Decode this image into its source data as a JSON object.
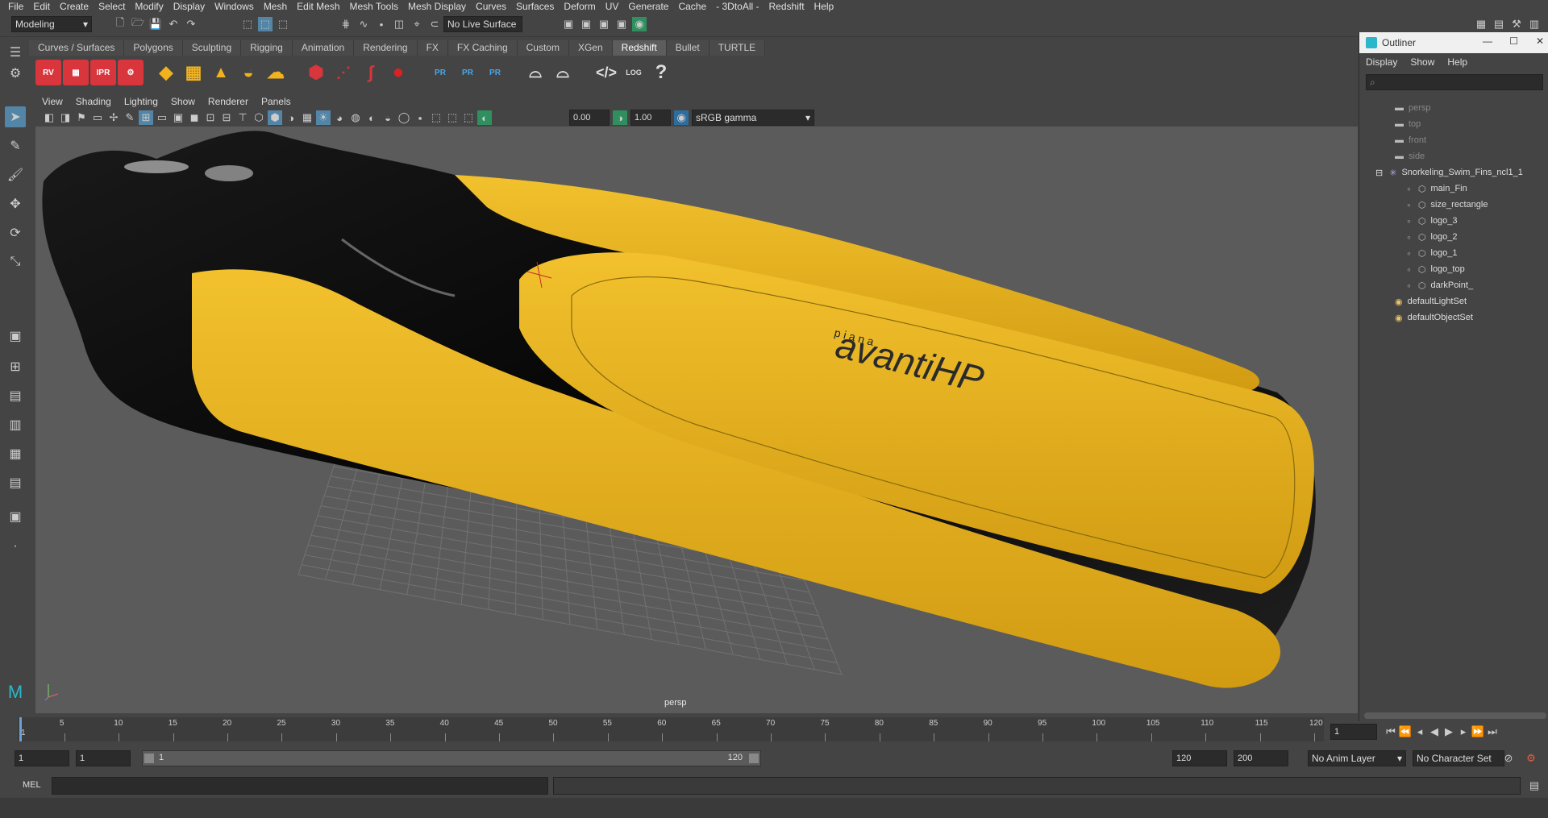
{
  "menubar": [
    "File",
    "Edit",
    "Create",
    "Select",
    "Modify",
    "Display",
    "Windows",
    "Mesh",
    "Edit Mesh",
    "Mesh Tools",
    "Mesh Display",
    "Curves",
    "Surfaces",
    "Deform",
    "UV",
    "Generate",
    "Cache",
    "- 3DtoAll -",
    "Redshift",
    "Help"
  ],
  "statusline": {
    "mode": "Modeling",
    "live_surface": "No Live Surface"
  },
  "shelf_tabs": [
    "Curves / Surfaces",
    "Polygons",
    "Sculpting",
    "Rigging",
    "Animation",
    "Rendering",
    "FX",
    "FX Caching",
    "Custom",
    "XGen",
    "Redshift",
    "Bullet",
    "TURTLE"
  ],
  "active_shelf_tab": "Redshift",
  "shelf_icons": {
    "rv": "RV",
    "ipr": "IPR",
    "pr": "PR",
    "log": "LOG"
  },
  "panel_menu": [
    "View",
    "Shading",
    "Lighting",
    "Show",
    "Renderer",
    "Panels"
  ],
  "panel_tools": {
    "exposure": "0.00",
    "gamma": "1.00",
    "color_space": "sRGB gamma"
  },
  "viewport": {
    "camera_label": "persp",
    "decal_brand": "avantiHP",
    "decal_sub": "p i a n a"
  },
  "outliner": {
    "title": "Outliner",
    "menu": [
      "Display",
      "Show",
      "Help"
    ],
    "items": [
      {
        "label": "persp",
        "type": "camera",
        "indent": 0,
        "dim": true
      },
      {
        "label": "top",
        "type": "camera",
        "indent": 0,
        "dim": true
      },
      {
        "label": "front",
        "type": "camera",
        "indent": 0,
        "dim": true
      },
      {
        "label": "side",
        "type": "camera",
        "indent": 0,
        "dim": true
      },
      {
        "label": "Snorkeling_Swim_Fins_ncl1_1",
        "type": "group",
        "indent": 0,
        "dim": false
      },
      {
        "label": "main_Fin",
        "type": "mesh",
        "indent": 1,
        "dim": false
      },
      {
        "label": "size_rectangle",
        "type": "mesh",
        "indent": 1,
        "dim": false
      },
      {
        "label": "logo_3",
        "type": "mesh",
        "indent": 1,
        "dim": false
      },
      {
        "label": "logo_2",
        "type": "mesh",
        "indent": 1,
        "dim": false
      },
      {
        "label": "logo_1",
        "type": "mesh",
        "indent": 1,
        "dim": false
      },
      {
        "label": "logo_top",
        "type": "mesh",
        "indent": 1,
        "dim": false
      },
      {
        "label": "darkPoint_",
        "type": "mesh",
        "indent": 1,
        "dim": false
      },
      {
        "label": "defaultLightSet",
        "type": "set",
        "indent": 0,
        "dim": false
      },
      {
        "label": "defaultObjectSet",
        "type": "set",
        "indent": 0,
        "dim": false
      }
    ]
  },
  "timeline": {
    "ticks": [
      "5",
      "10",
      "15",
      "20",
      "25",
      "30",
      "35",
      "40",
      "45",
      "50",
      "55",
      "60",
      "65",
      "70",
      "75",
      "80",
      "85",
      "90",
      "95",
      "100",
      "105",
      "110",
      "115",
      "120"
    ],
    "start_marker": "1",
    "current_frame": "1"
  },
  "range": {
    "start": "1",
    "start2": "1",
    "slider_start": "1",
    "slider_end": "120",
    "end": "120",
    "end2": "200",
    "anim_layer": "No Anim Layer",
    "character_set": "No Character Set"
  },
  "cmdline": {
    "label": "MEL"
  },
  "colors": {
    "fin_yellow": "#e8b422",
    "fin_black": "#0d0d0d",
    "viewport_bg": "#5b5b5b",
    "active_tab": "#5d5d5d"
  }
}
